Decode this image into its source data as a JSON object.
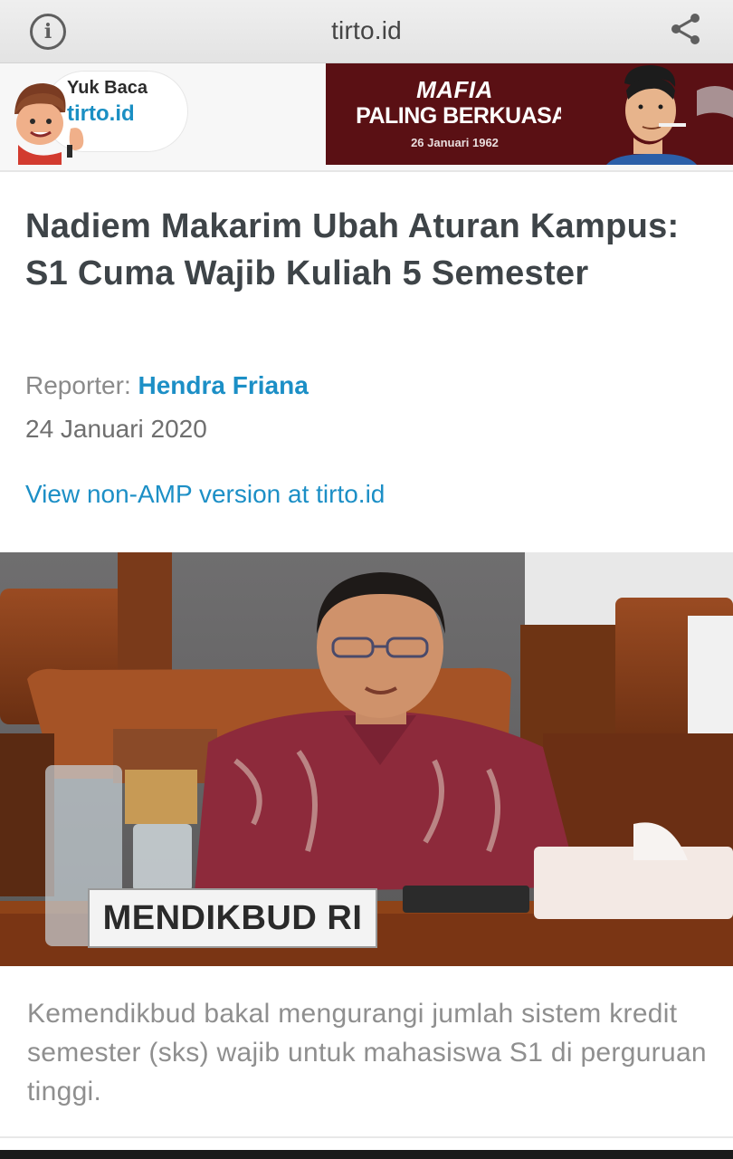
{
  "browser": {
    "url": "tirto.id",
    "info_icon": "info-icon",
    "share_icon": "share-icon"
  },
  "logo": {
    "line1": "Yuk Baca",
    "line2": "tirto.id"
  },
  "ad": {
    "line1": "MAFIA",
    "line2": "PALING BERKUASA",
    "date": "26 Januari 1962"
  },
  "article": {
    "headline": "Nadiem Makarim Ubah Aturan Kampus: S1 Cuma Wajib Kuliah 5 Semester",
    "reporter_label": "Reporter:",
    "reporter_name": "Hendra Friana",
    "date": "24 Januari 2020",
    "non_amp_link": "View non-AMP version at tirto.id",
    "photo_nameplate": "MENDIKBUD RI",
    "caption": "Kemendikbud bakal mengurangi jumlah sistem kredit semester (sks) wajib untuk mahasiswa S1 di perguruan tinggi."
  },
  "colors": {
    "accent": "#1c8fc6",
    "headline": "#3e4448",
    "ad_background": "#5a1014"
  }
}
